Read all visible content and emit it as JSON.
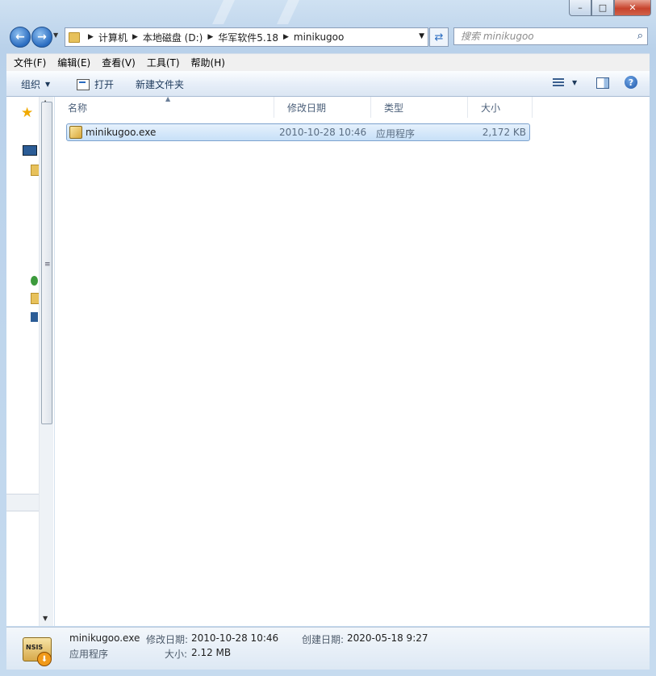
{
  "window": {
    "minimize": "–",
    "maximize": "□",
    "close": "✕"
  },
  "nav": {
    "back_icon": "arrow-left",
    "forward_icon": "arrow-right"
  },
  "address": {
    "crumbs": [
      "计算机",
      "本地磁盘 (D:)",
      "华军软件5.18",
      "minikugoo"
    ]
  },
  "search": {
    "placeholder": "搜索 minikugoo"
  },
  "menu": [
    "文件(F)",
    "编辑(E)",
    "查看(V)",
    "工具(T)",
    "帮助(H)"
  ],
  "toolbar": {
    "organize": "组织",
    "open": "打开",
    "new_folder": "新建文件夹"
  },
  "columns": {
    "name": "名称",
    "modified": "修改日期",
    "type": "类型",
    "size": "大小"
  },
  "files": [
    {
      "name": "minikugoo.exe",
      "modified": "2010-10-28 10:46",
      "type": "应用程序",
      "size": "2,172 KB"
    }
  ],
  "details": {
    "filename": "minikugoo.exe",
    "type": "应用程序",
    "modified_label": "修改日期:",
    "modified_value": "2010-10-28 10:46",
    "size_label": "大小:",
    "size_value": "2.12 MB",
    "created_label": "创建日期:",
    "created_value": "2020-05-18 9:27",
    "icon_text": "NSIS"
  }
}
